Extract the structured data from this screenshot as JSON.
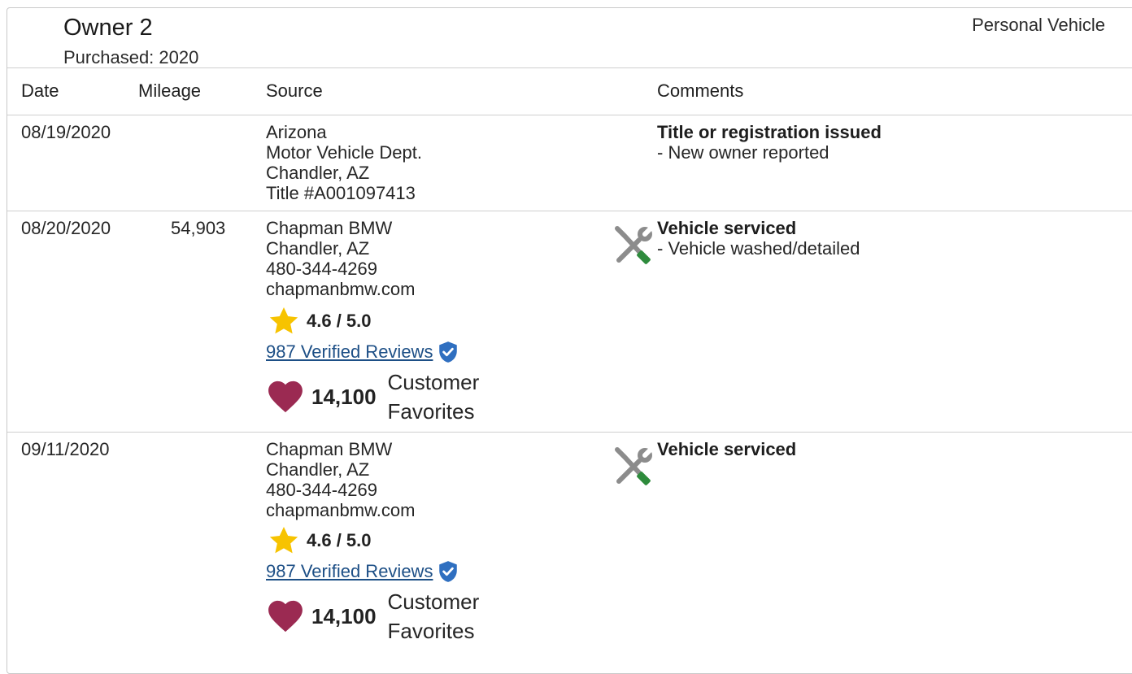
{
  "owner": {
    "title": "Owner 2",
    "purchased": "Purchased: 2020",
    "vehicle_type": "Personal Vehicle"
  },
  "columns": {
    "date": "Date",
    "mileage": "Mileage",
    "source": "Source",
    "comments": "Comments"
  },
  "colors": {
    "star": "#f7c300",
    "heart": "#9b2a52",
    "link": "#1d4f86",
    "shield": "#2f6fc0",
    "tool_gray": "#8c8c8c",
    "tool_green": "#2e8b3c"
  },
  "rows": [
    {
      "date": "08/19/2020",
      "mileage": "",
      "source": [
        "Arizona",
        "Motor Vehicle Dept.",
        "Chandler, AZ",
        "Title #A001097413"
      ],
      "comment_title": "Title or registration issued",
      "comment_detail": "- New owner reported"
    },
    {
      "date": "08/20/2020",
      "mileage": "54,903",
      "source": [
        "Chapman BMW",
        "Chandler, AZ",
        "480-344-4269",
        "chapmanbmw.com"
      ],
      "icon": "service-tools-icon",
      "rating": "4.6 / 5.0",
      "reviews": "987 Verified Reviews",
      "favorites_count": "14,100",
      "favorites_label": [
        "Customer",
        "Favorites"
      ],
      "comment_title": "Vehicle serviced",
      "comment_detail": "- Vehicle washed/detailed"
    },
    {
      "date": "09/11/2020",
      "mileage": "",
      "source": [
        "Chapman BMW",
        "Chandler, AZ",
        "480-344-4269",
        "chapmanbmw.com"
      ],
      "icon": "service-tools-icon",
      "rating": "4.6 / 5.0",
      "reviews": "987 Verified Reviews",
      "favorites_count": "14,100",
      "favorites_label": [
        "Customer",
        "Favorites"
      ],
      "comment_title": "Vehicle serviced",
      "comment_detail": ""
    }
  ]
}
